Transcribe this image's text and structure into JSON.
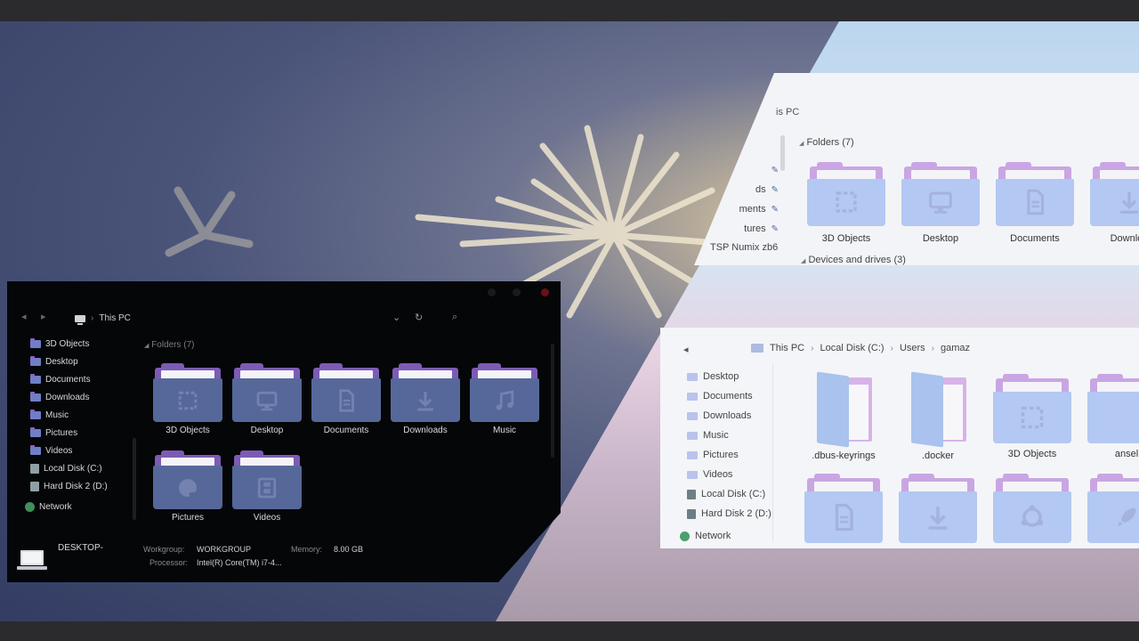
{
  "colors": {
    "dark_folder_front": "#56689a",
    "dark_folder_back": "#7d5bb5",
    "light_folder_front": "#b3c8f2",
    "light_folder_back": "#c9a6e3",
    "glyph_dark": "#a9b4d8",
    "glyph_light": "#8a8fb6"
  },
  "dark_explorer": {
    "nav_back": "◂",
    "nav_forward": "▸",
    "path_sep": "›",
    "path": "This PC",
    "toolbar_dropdown": "⌄",
    "toolbar_refresh": "↻",
    "toolbar_search": "⌕",
    "sidebar": [
      {
        "label": "3D Objects",
        "icon": "folder-icon"
      },
      {
        "label": "Desktop",
        "icon": "folder-icon"
      },
      {
        "label": "Documents",
        "icon": "folder-icon"
      },
      {
        "label": "Downloads",
        "icon": "folder-icon"
      },
      {
        "label": "Music",
        "icon": "folder-icon"
      },
      {
        "label": "Pictures",
        "icon": "folder-icon"
      },
      {
        "label": "Videos",
        "icon": "folder-icon"
      },
      {
        "label": "Local Disk (C:)",
        "icon": "drive-icon"
      },
      {
        "label": "Hard Disk 2 (D:)",
        "icon": "drive-icon"
      }
    ],
    "network": "Network",
    "group_chevron": "◢",
    "group_title": "Folders (7)",
    "folders": [
      {
        "label": "3D Objects",
        "icon": "cube-icon"
      },
      {
        "label": "Desktop",
        "icon": "monitor-icon"
      },
      {
        "label": "Documents",
        "icon": "document-icon"
      },
      {
        "label": "Downloads",
        "icon": "download-icon"
      },
      {
        "label": "Music",
        "icon": "music-icon"
      },
      {
        "label": "Pictures",
        "icon": "palette-icon"
      },
      {
        "label": "Videos",
        "icon": "film-icon"
      }
    ],
    "computer_name": "DESKTOP-",
    "workgroup_label": "Workgroup:",
    "workgroup_value": "WORKGROUP",
    "memory_label": "Memory:",
    "memory_value": "8.00 GB",
    "processor_label": "Processor:",
    "processor_value": "Intel(R) Core(TM) i7-4..."
  },
  "light_explorer_top": {
    "title": "is PC",
    "group_folders_chevron": "◢",
    "group_folders": "Folders (7)",
    "group_devices_chevron": "◢",
    "group_devices": "Devices and drives (3)",
    "pin_glyph": "✎",
    "pinned": [
      "",
      "ds",
      "ments",
      "tures"
    ],
    "pinned_extra": "TSP Numix zb6",
    "folders": [
      {
        "label": "3D Objects",
        "icon": "cube-icon"
      },
      {
        "label": "Desktop",
        "icon": "monitor-icon"
      },
      {
        "label": "Documents",
        "icon": "document-icon"
      },
      {
        "label": "Downloa",
        "icon": "download-icon"
      }
    ]
  },
  "light_explorer_bottom": {
    "nav_back": "◂",
    "path_sep": "›",
    "path": [
      "This PC",
      "Local Disk (C:)",
      "Users",
      "gamaz"
    ],
    "sidebar": [
      {
        "label": "Desktop",
        "icon": "folder-icon"
      },
      {
        "label": "Documents",
        "icon": "folder-icon"
      },
      {
        "label": "Downloads",
        "icon": "folder-icon"
      },
      {
        "label": "Music",
        "icon": "folder-icon"
      },
      {
        "label": "Pictures",
        "icon": "folder-icon"
      },
      {
        "label": "Videos",
        "icon": "folder-icon"
      },
      {
        "label": "Local Disk (C:)",
        "icon": "drive-icon"
      },
      {
        "label": "Hard Disk 2 (D:)",
        "icon": "drive-icon"
      }
    ],
    "network": "Network",
    "items_row1": [
      {
        "label": ".dbus-keyrings",
        "icon": "open-folder-icon"
      },
      {
        "label": ".docker",
        "icon": "open-folder-icon"
      },
      {
        "label": "3D Objects",
        "icon": "cube-icon"
      },
      {
        "label": "ansel",
        "icon": "folder-icon"
      }
    ],
    "items_row2": [
      {
        "label": "",
        "icon": "document-icon"
      },
      {
        "label": "",
        "icon": "download-icon"
      },
      {
        "label": "",
        "icon": "ubuntu-icon"
      },
      {
        "label": "",
        "icon": "rocket-icon"
      }
    ]
  }
}
